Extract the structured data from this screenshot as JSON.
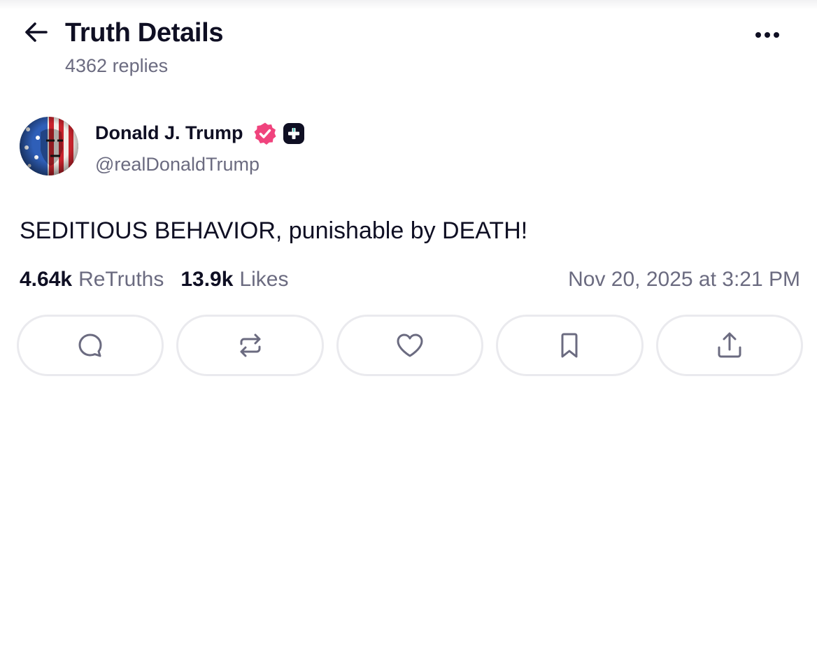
{
  "header": {
    "title": "Truth Details",
    "replies": "4362 replies",
    "back_icon": "arrow-left-icon",
    "more_icon": "ellipsis-horizontal-icon"
  },
  "post": {
    "author_name": "Donald J. Trump",
    "handle": "@realDonaldTrump",
    "verified_icon": "verified-badge-icon",
    "plus_icon": "plus-badge-icon",
    "text": "SEDITIOUS BEHAVIOR, punishable by DEATH!",
    "retruths_count": "4.64k",
    "retruths_label": "ReTruths",
    "likes_count": "13.9k",
    "likes_label": "Likes",
    "timestamp": "Nov 20, 2025 at 3:21 PM"
  },
  "actions": [
    {
      "icon": "reply-bubble-icon"
    },
    {
      "icon": "retruth-repeat-icon"
    },
    {
      "icon": "heart-icon"
    },
    {
      "icon": "bookmark-icon"
    },
    {
      "icon": "share-upload-icon"
    }
  ],
  "colors": {
    "text_primary": "#0f0f23",
    "text_secondary": "#6b6b80",
    "verified_pink": "#f0437d",
    "button_border": "#eaeaee"
  }
}
